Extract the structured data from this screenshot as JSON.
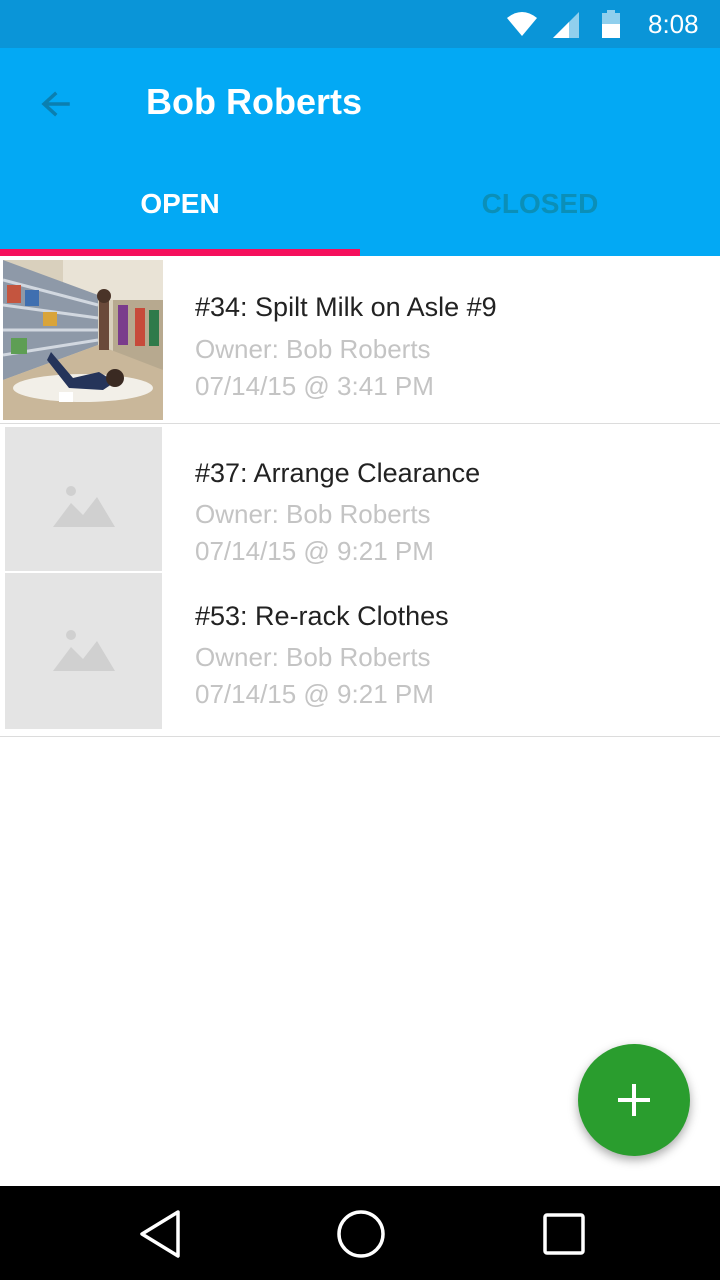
{
  "status_bar": {
    "time": "8:08",
    "icons": [
      "wifi-icon",
      "cell-signal-icon",
      "battery-icon"
    ]
  },
  "app_bar": {
    "title": "Bob Roberts",
    "back_icon": "arrow-back-icon",
    "tabs": [
      {
        "label": "OPEN",
        "selected": true
      },
      {
        "label": "CLOSED",
        "selected": false
      }
    ]
  },
  "tickets": [
    {
      "title": "#34: Spilt Milk on Asle #9",
      "owner": "Owner: Bob Roberts",
      "timestamp": "07/14/15 @ 3:41 PM",
      "thumbnail": "photo"
    },
    {
      "title": "#37: Arrange Clearance",
      "owner": "Owner: Bob Roberts",
      "timestamp": "07/14/15 @ 9:21 PM",
      "thumbnail": "image-placeholder-icon"
    },
    {
      "title": "#53: Re-rack Clothes",
      "owner": "Owner: Bob Roberts",
      "timestamp": "07/14/15 @ 9:21 PM",
      "thumbnail": "image-placeholder-icon"
    }
  ],
  "fab": {
    "icon": "plus-icon"
  },
  "nav_bar": {
    "icons": [
      "back-triangle-icon",
      "home-circle-icon",
      "recents-square-icon"
    ]
  },
  "colors": {
    "status_bar": "#0a95d8",
    "app_bar": "#03a9f4",
    "tab_indicator": "#f50f5c",
    "inactive_tab": "#0b8fb8",
    "fab": "#2a9d2e"
  }
}
